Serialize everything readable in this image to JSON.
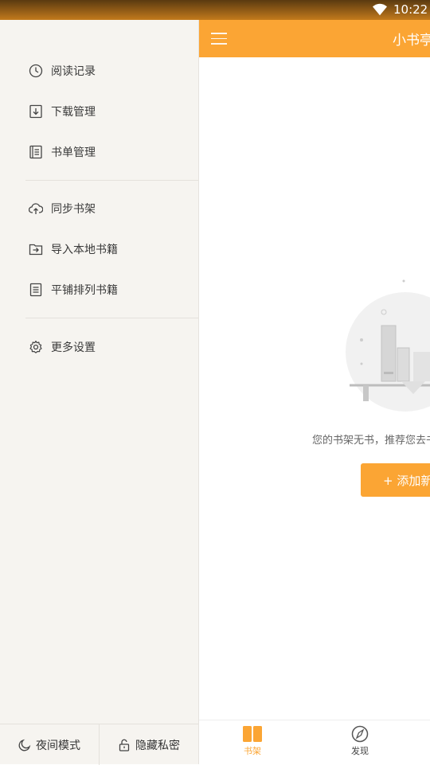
{
  "status_bar": {
    "time": "10:22"
  },
  "app_bar": {
    "title": "小书亭"
  },
  "drawer": {
    "groups": [
      {
        "items": [
          {
            "label": "阅读记录",
            "icon": "clock-icon"
          },
          {
            "label": "下载管理",
            "icon": "download-icon"
          },
          {
            "label": "书单管理",
            "icon": "booklist-icon"
          }
        ]
      },
      {
        "items": [
          {
            "label": "同步书架",
            "icon": "cloud-sync-icon"
          },
          {
            "label": "导入本地书籍",
            "icon": "import-folder-icon"
          },
          {
            "label": "平铺排列书籍",
            "icon": "list-layout-icon"
          }
        ]
      },
      {
        "items": [
          {
            "label": "更多设置",
            "icon": "gear-icon"
          }
        ]
      }
    ],
    "bottom": {
      "night_mode": "夜间模式",
      "hide_private": "隐藏私密"
    }
  },
  "main": {
    "empty_text": "您的书架无书，推荐您去书城看看",
    "add_button": "+ 添加新书"
  },
  "bottom_nav": {
    "items": [
      {
        "label": "书架",
        "icon": "bookshelf-icon",
        "active": true
      },
      {
        "label": "发现",
        "icon": "compass-icon",
        "active": false
      }
    ]
  },
  "colors": {
    "accent": "#FBA534",
    "drawer_bg": "#F6F4F0"
  }
}
